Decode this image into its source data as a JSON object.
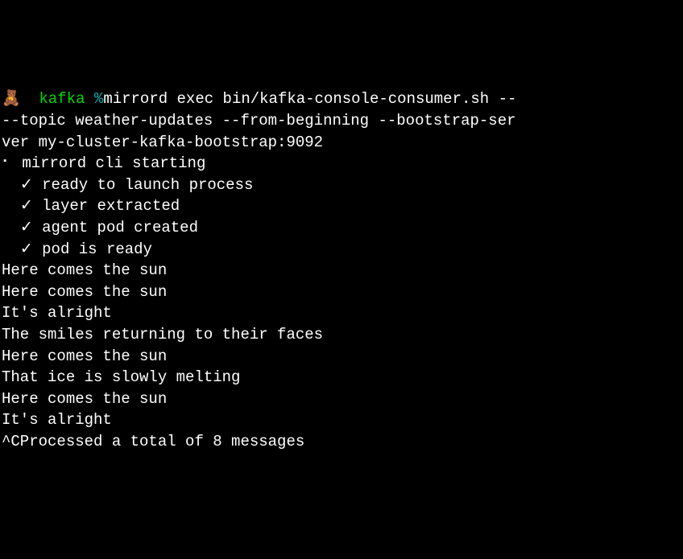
{
  "prompt": {
    "icon": "🧸",
    "dir": "kafka",
    "percent": "%"
  },
  "command": {
    "line1": "mirrord exec bin/kafka-console-consumer.sh -- ",
    "line2": "--topic weather-updates --from-beginning --bootstrap-ser",
    "line3": "ver my-cluster-kafka-bootstrap:9092"
  },
  "cli_start": {
    "spinner": "⠂",
    "text": "mirrord cli starting"
  },
  "steps": [
    {
      "check": "✓",
      "text": "ready to launch process"
    },
    {
      "check": "✓",
      "text": "layer extracted"
    },
    {
      "check": "✓",
      "text": "agent pod created"
    },
    {
      "check": "✓",
      "text": "pod is ready"
    }
  ],
  "output": [
    "Here comes the sun",
    "Here comes the sun",
    "It's alright",
    "The smiles returning to their faces",
    "Here comes the sun",
    "That ice is slowly melting",
    "Here comes the sun",
    "It's alright",
    "^CProcessed a total of 8 messages"
  ]
}
